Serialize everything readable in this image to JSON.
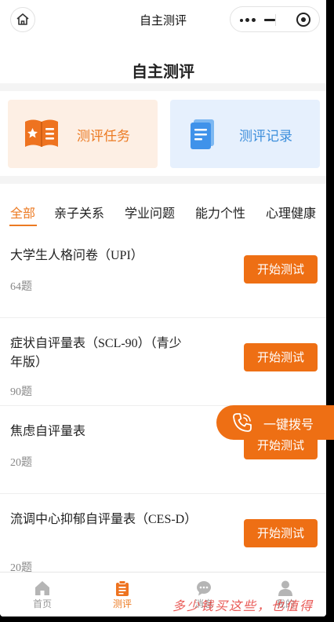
{
  "navbar": {
    "title": "自主测评"
  },
  "page": {
    "title": "自主测评"
  },
  "cards": [
    {
      "label": "测评任务",
      "icon": "book-list-icon"
    },
    {
      "label": "测评记录",
      "icon": "document-icon"
    }
  ],
  "tabs": [
    "全部",
    "亲子关系",
    "学业问题",
    "能力个性",
    "心理健康"
  ],
  "active_tab": "全部",
  "assessments": [
    {
      "title": "大学生人格问卷（UPI）",
      "count": "64题",
      "button": "开始测试"
    },
    {
      "title": "症状自评量表（SCL-90）（青少年版）",
      "count": "90题",
      "button": "开始测试"
    },
    {
      "title": "焦虑自评量表",
      "count": "20题",
      "button": "开始测试"
    },
    {
      "title": "流调中心抑郁自评量表（CES-D）",
      "count": "20题",
      "button": "开始测试"
    }
  ],
  "dial": {
    "label": "一键拨号",
    "icon": "phone-icon"
  },
  "bottom_nav": [
    {
      "label": "首页",
      "icon": "home-icon"
    },
    {
      "label": "测评",
      "icon": "clipboard-icon"
    },
    {
      "label": "消息",
      "icon": "chat-icon"
    },
    {
      "label": "我的",
      "icon": "user-icon"
    }
  ],
  "watermark": "多少钱买这些，也值得",
  "colors": {
    "accent": "#ee6f14",
    "task_bg": "#fdefe4",
    "record_bg": "#e6f0fd",
    "record_text": "#3d8fdc"
  }
}
